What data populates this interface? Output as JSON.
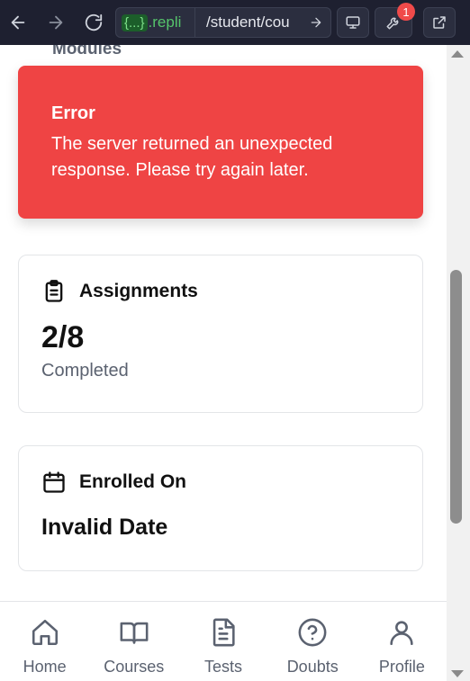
{
  "browser": {
    "url_host_braces": "{...}",
    "url_host": ".repli",
    "url_path": "/student/cou",
    "notification_count": "1"
  },
  "page": {
    "section_heading": "Modules"
  },
  "error": {
    "title": "Error",
    "message": "The server returned an unexpected response. Please try again later."
  },
  "assignments": {
    "title": "Assignments",
    "value": "2/8",
    "caption": "Completed"
  },
  "enrollment": {
    "title": "Enrolled On",
    "value": "Invalid Date"
  },
  "bottom_nav": {
    "items": [
      {
        "label": "Home",
        "icon": "home-icon"
      },
      {
        "label": "Courses",
        "icon": "book-icon"
      },
      {
        "label": "Tests",
        "icon": "document-icon"
      },
      {
        "label": "Doubts",
        "icon": "question-icon"
      },
      {
        "label": "Profile",
        "icon": "user-icon"
      }
    ]
  },
  "colors": {
    "error_bg": "#ef4444",
    "text_muted": "#5b6270",
    "chrome_bg": "#1e2030"
  }
}
